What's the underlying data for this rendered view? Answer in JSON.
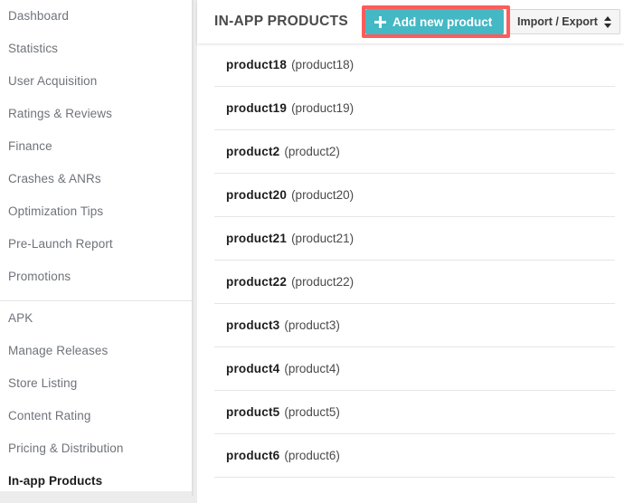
{
  "sidebar": {
    "groups": [
      {
        "name": "primary",
        "items": [
          {
            "label": "Dashboard",
            "active": false
          },
          {
            "label": "Statistics",
            "active": false
          },
          {
            "label": "User Acquisition",
            "active": false
          },
          {
            "label": "Ratings & Reviews",
            "active": false
          },
          {
            "label": "Finance",
            "active": false
          },
          {
            "label": "Crashes & ANRs",
            "active": false
          },
          {
            "label": "Optimization Tips",
            "active": false
          },
          {
            "label": "Pre-Launch Report",
            "active": false
          },
          {
            "label": "Promotions",
            "active": false
          }
        ]
      },
      {
        "name": "store",
        "items": [
          {
            "label": "APK",
            "active": false
          },
          {
            "label": "Manage Releases",
            "active": false
          },
          {
            "label": "Store Listing",
            "active": false
          },
          {
            "label": "Content Rating",
            "active": false
          },
          {
            "label": "Pricing & Distribution",
            "active": false
          },
          {
            "label": "In-app Products",
            "active": true
          }
        ]
      }
    ]
  },
  "header": {
    "title": "IN-APP PRODUCTS",
    "add_button_label": "Add new product",
    "add_button_icon": "plus-icon",
    "import_export_label": "Import / Export",
    "import_export_icon": "sort-updown-icon"
  },
  "colors": {
    "accent_teal": "#44b8c4",
    "highlight_red": "#ff5c5c",
    "page_background": "#ececec",
    "card_background": "#ffffff",
    "row_divider": "#e6e6e6",
    "nav_text": "#6f737a",
    "nav_active_text": "#1b1b1b"
  },
  "main": {
    "products": [
      {
        "name": "product18",
        "sku": "(product18)"
      },
      {
        "name": "product19",
        "sku": "(product19)"
      },
      {
        "name": "product2",
        "sku": "(product2)"
      },
      {
        "name": "product20",
        "sku": "(product20)"
      },
      {
        "name": "product21",
        "sku": "(product21)"
      },
      {
        "name": "product22",
        "sku": "(product22)"
      },
      {
        "name": "product3",
        "sku": "(product3)"
      },
      {
        "name": "product4",
        "sku": "(product4)"
      },
      {
        "name": "product5",
        "sku": "(product5)"
      },
      {
        "name": "product6",
        "sku": "(product6)"
      }
    ]
  }
}
